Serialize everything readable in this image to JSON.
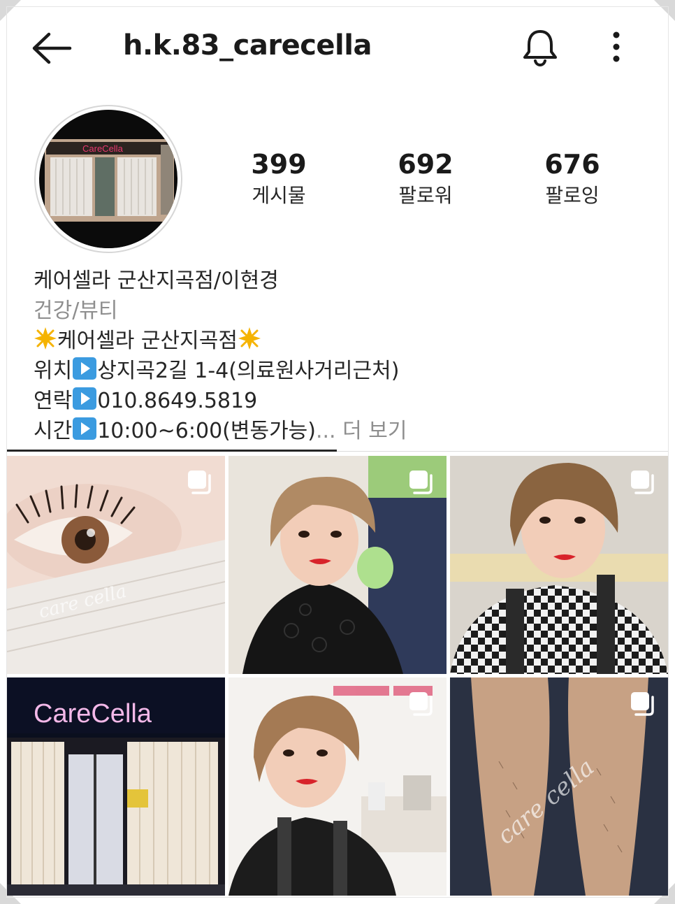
{
  "header": {
    "username": "h.k.83_carecella",
    "back_icon": "arrow-left-icon",
    "bell_icon": "bell-icon",
    "more_icon": "more-vertical-icon"
  },
  "avatar": {
    "storefront_sign": "CareCella"
  },
  "stats": [
    {
      "value": "399",
      "label": "게시물"
    },
    {
      "value": "692",
      "label": "팔로워"
    },
    {
      "value": "676",
      "label": "팔로잉"
    }
  ],
  "bio": {
    "name": "케어셀라 군산지곡점/이현경",
    "category": "건강/뷰티",
    "line1": "케어셀라 군산지곡점",
    "line2_label": "위치",
    "line2_value": "상지곡2길 1-4(의료원사거리근처)",
    "line3_label": "연락",
    "line3_value": "010.8649.5819",
    "line4_label": "시간",
    "line4_value": "10:00~6:00(변동가능)",
    "ellipsis": "...",
    "more_link": "더 보기"
  },
  "grid": {
    "posts": [
      {
        "subject": "eyelash-closeup",
        "watermark": "care cella",
        "multi": true
      },
      {
        "subject": "woman-portrait-black-lace",
        "multi": true
      },
      {
        "subject": "woman-portrait-checkered",
        "multi": true
      },
      {
        "subject": "storefront-night",
        "sign": "CareCella",
        "multi": false
      },
      {
        "subject": "woman-portrait-apron",
        "multi": true
      },
      {
        "subject": "legs-before-waxing",
        "watermark": "care cella",
        "multi": true
      }
    ]
  },
  "colors": {
    "text": "#262626",
    "muted": "#8e8e8e",
    "lips": "#d8232a",
    "sign_pink": "#e9386f"
  }
}
